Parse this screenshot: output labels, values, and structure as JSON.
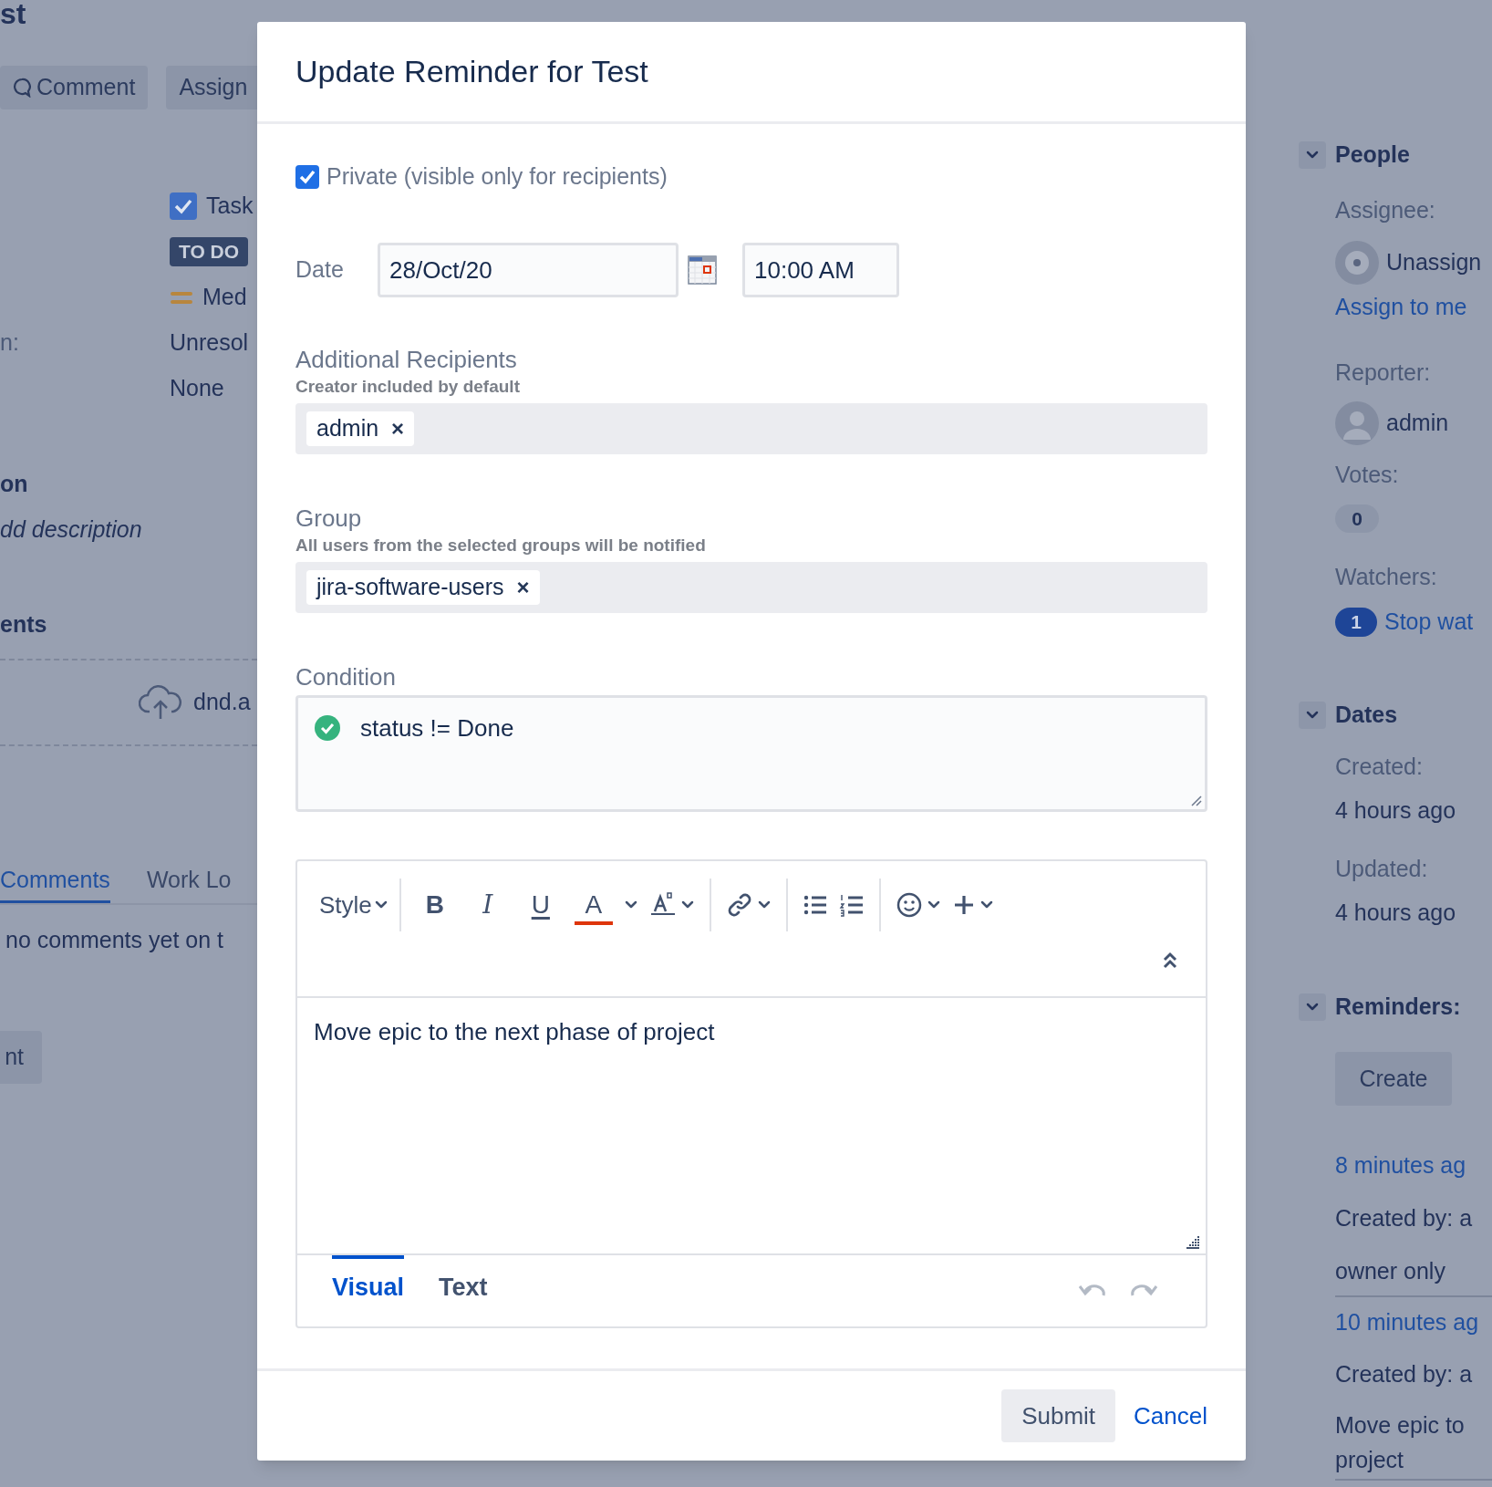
{
  "page": {
    "title_fragment": "st",
    "toolbar": [
      {
        "kind": "comment",
        "label": "Comment"
      },
      {
        "kind": "plain",
        "label": "Assign"
      }
    ],
    "details": [
      {
        "kind": "type",
        "value": "Task"
      },
      {
        "kind": "status",
        "value": "TO DO"
      },
      {
        "kind": "priority",
        "value": "Med"
      },
      {
        "kind": "text",
        "label": "n:",
        "value": "Unresol"
      },
      {
        "kind": "text",
        "value": "None"
      }
    ],
    "description": {
      "heading": "on",
      "prompt": "dd description"
    },
    "attachments": {
      "heading": "ents",
      "drop_text": "dnd.a"
    },
    "activity_tabs": [
      {
        "label": "Comments",
        "selected": true
      },
      {
        "label": "Work Lo",
        "selected": false
      }
    ],
    "activity_message": "no comments yet on t",
    "comment_button": "nt"
  },
  "sidebar": {
    "people": {
      "heading": "People",
      "expanded": true,
      "assignee_label": "Assignee:",
      "assignee": "Unassign",
      "assign_link": "Assign to me",
      "reporter_label": "Reporter:",
      "reporter": "admin",
      "votes_label": "Votes:",
      "votes": "0",
      "watchers_label": "Watchers:",
      "watchers": "1",
      "watch_link": "Stop wat"
    },
    "dates": {
      "heading": "Dates",
      "expanded": true,
      "created_label": "Created:",
      "created": "4 hours ago",
      "updated_label": "Updated:",
      "updated": "4 hours ago"
    },
    "reminders": {
      "heading": "Reminders:",
      "expanded": true,
      "create_button": "Create",
      "items": [
        {
          "time": "8 minutes ag",
          "created_by": "Created by: a",
          "text": "owner only"
        },
        {
          "time": "10 minutes ag",
          "created_by": "Created by: a",
          "text": "Move epic to project"
        }
      ]
    }
  },
  "dialog": {
    "title": "Update Reminder for Test",
    "private": {
      "label": "Private (visible only for recipients)",
      "checked": true
    },
    "date": {
      "label": "Date",
      "value": "28/Oct/20",
      "time": "10:00 AM"
    },
    "recipients": {
      "label": "Additional Recipients",
      "help": "Creator included by default",
      "tags": [
        {
          "label": "admin",
          "remove": "×"
        }
      ]
    },
    "group": {
      "label": "Group",
      "help": "All users from the selected groups will be notified",
      "tags": [
        {
          "label": "jira-software-users",
          "remove": "×"
        }
      ]
    },
    "condition": {
      "label": "Condition",
      "valid": true,
      "value": "status != Done"
    },
    "editor": {
      "style_menu": "Style",
      "format_buttons": [
        {
          "kind": "bold",
          "label": "B"
        },
        {
          "kind": "italic",
          "label": "I"
        },
        {
          "kind": "underline",
          "label": "U"
        },
        {
          "kind": "color",
          "label": "A"
        }
      ],
      "content": "Move epic to the next phase of project",
      "tabs": [
        {
          "label": "Visual",
          "selected": true
        },
        {
          "label": "Text",
          "selected": false
        }
      ],
      "history": [
        {
          "kind": "undo",
          "disabled": true
        },
        {
          "kind": "redo",
          "disabled": true
        }
      ]
    },
    "buttons": {
      "submit": "Submit",
      "cancel": "Cancel"
    }
  }
}
